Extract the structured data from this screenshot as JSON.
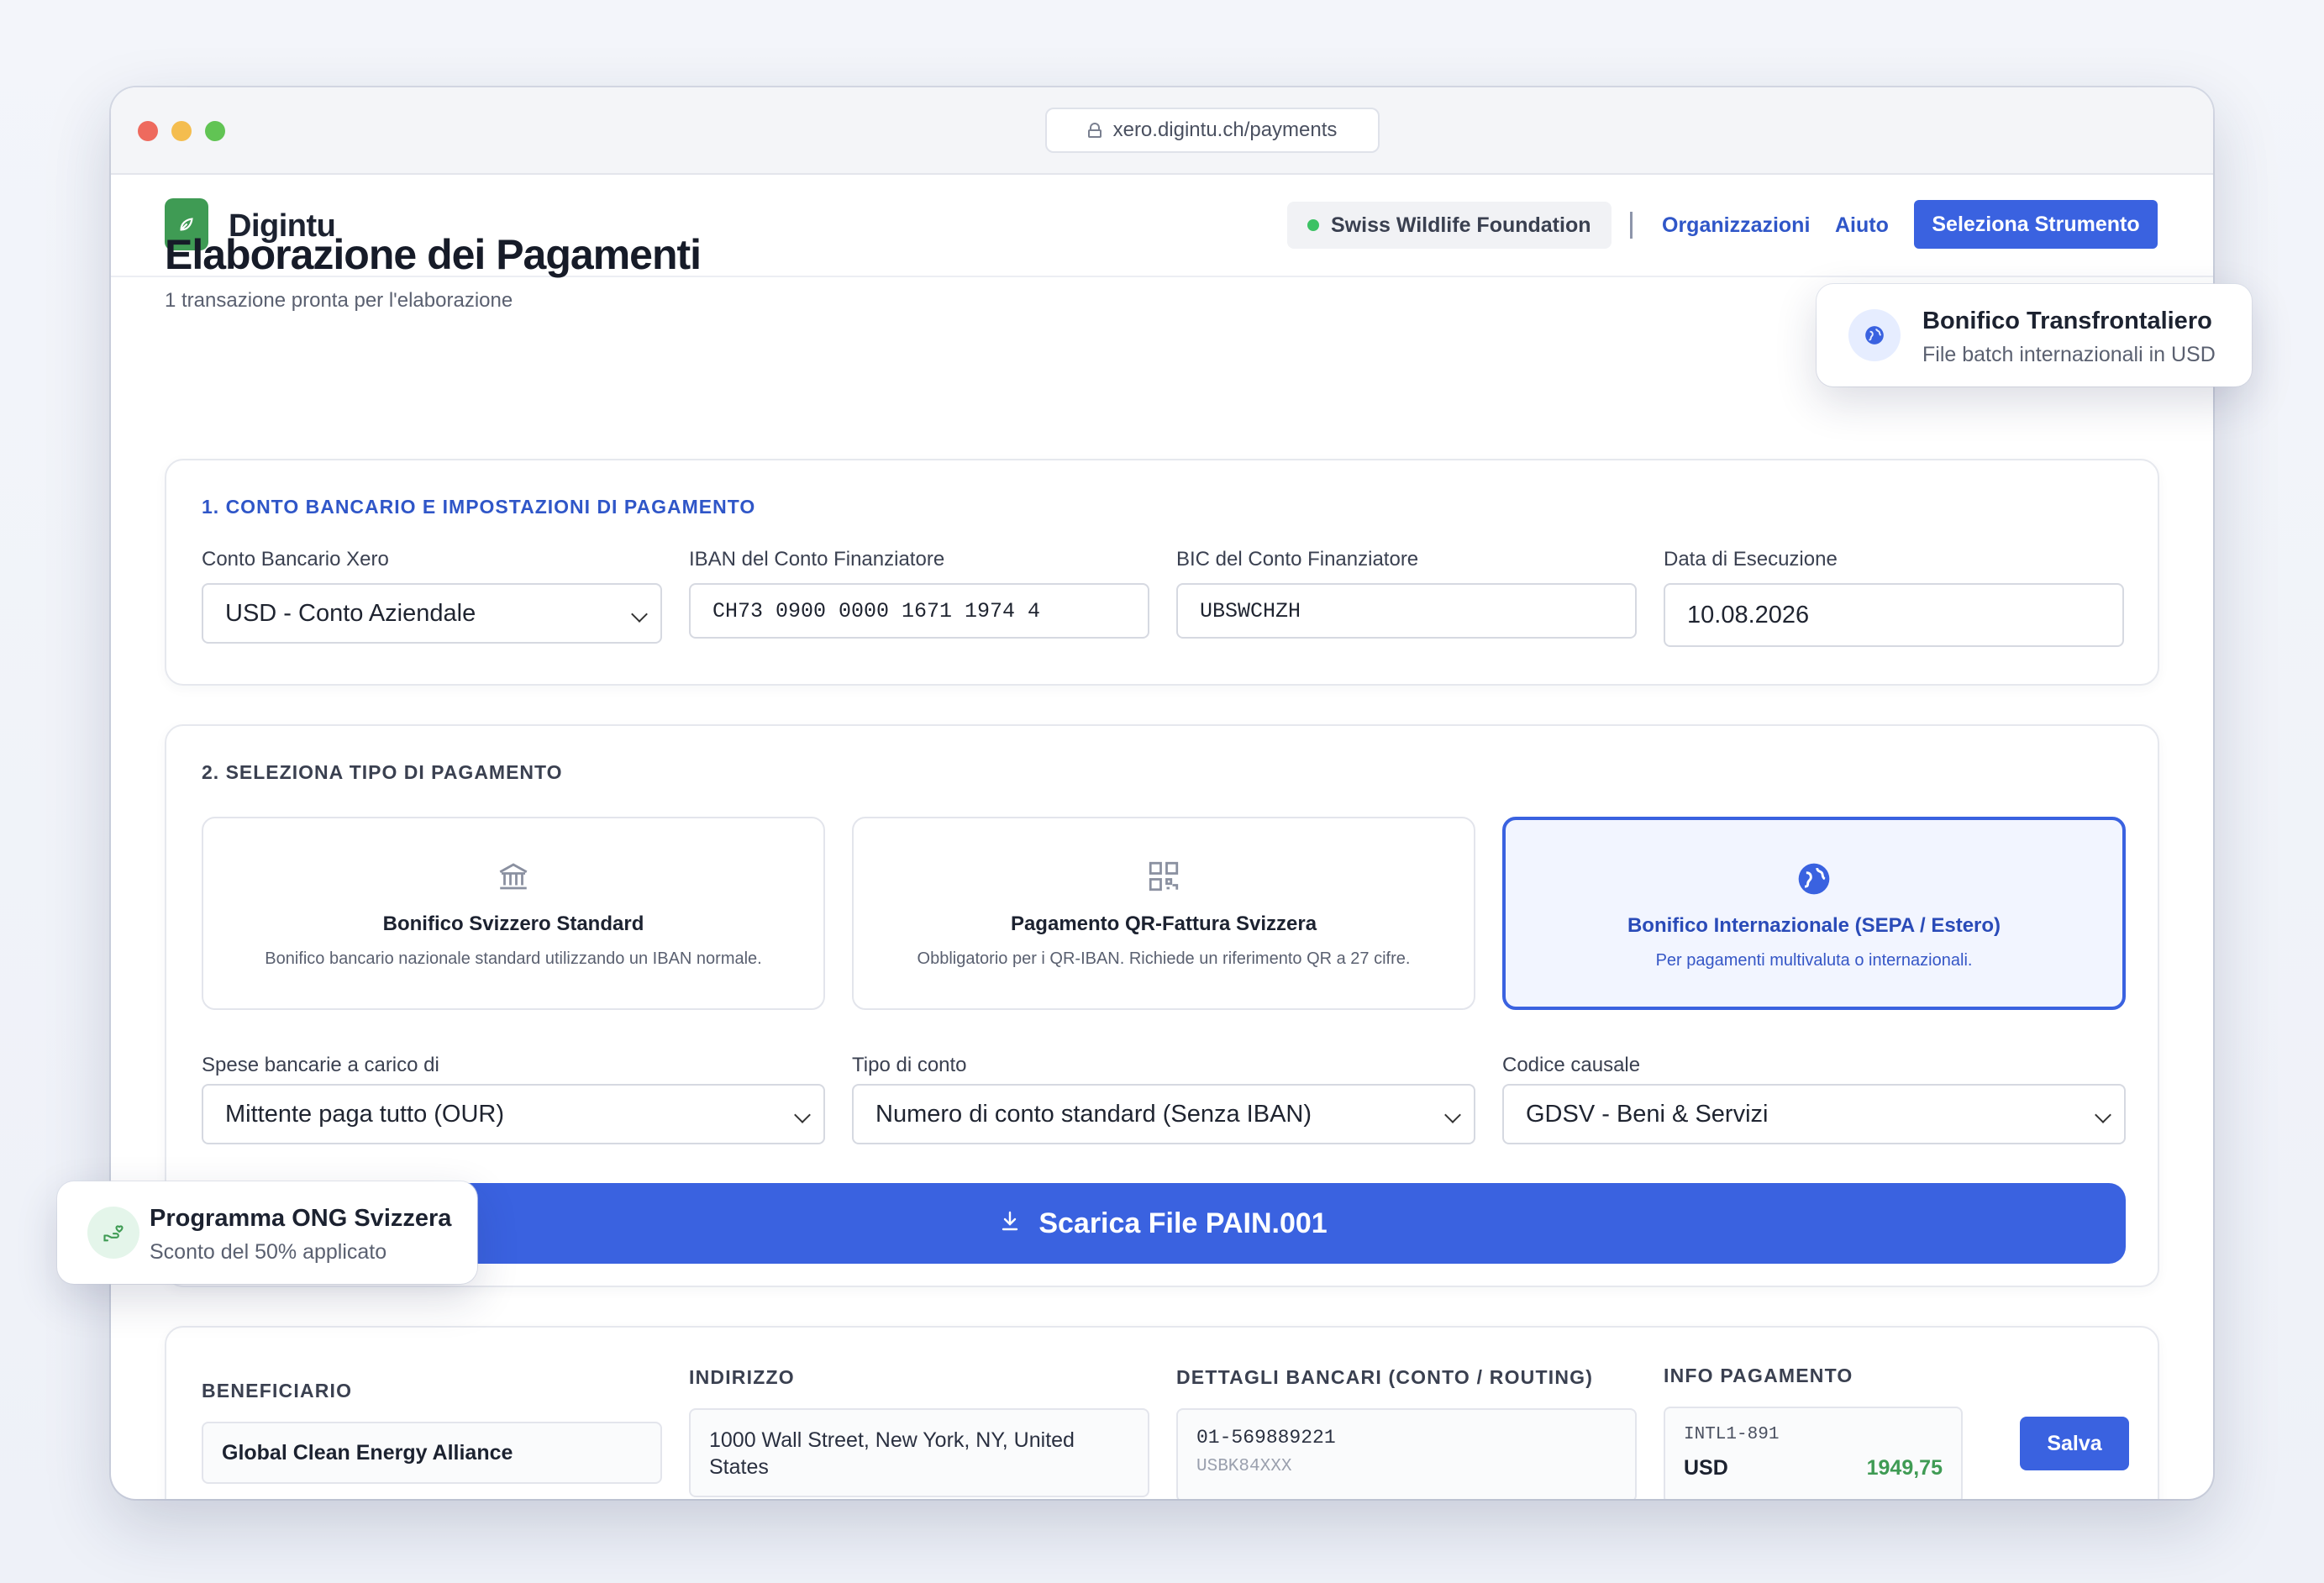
{
  "browser": {
    "url": "xero.digintu.ch/payments"
  },
  "header": {
    "brand": "Digintu",
    "organization": "Swiss Wildlife Foundation",
    "nav": {
      "organizations": "Organizzazioni",
      "help": "Aiuto"
    },
    "select_tool": "Seleziona Strumento"
  },
  "page": {
    "title": "Elaborazione dei Pagamenti",
    "subtitle": "1 transazione pronta per l'elaborazione"
  },
  "section1": {
    "title": "1. CONTO BANCARIO E IMPOSTAZIONI DI PAGAMENTO",
    "xero_account": {
      "label": "Conto Bancario Xero",
      "value": "USD - Conto Aziendale"
    },
    "iban": {
      "label": "IBAN del Conto Finanziatore",
      "value": "CH73 0900 0000 1671 1974 4"
    },
    "bic": {
      "label": "BIC del Conto Finanziatore",
      "value": "UBSWCHZH"
    },
    "date": {
      "label": "Data di Esecuzione",
      "value": "10.08.2026"
    }
  },
  "section2": {
    "title": "2. SELEZIONA TIPO DI PAGAMENTO",
    "types": [
      {
        "title": "Bonifico Svizzero Standard",
        "desc": "Bonifico bancario nazionale standard utilizzando un IBAN normale.",
        "icon": "bank-icon"
      },
      {
        "title": "Pagamento QR-Fattura Svizzera",
        "desc": "Obbligatorio per i QR-IBAN. Richiede un riferimento QR a 27 cifre.",
        "icon": "qr-icon"
      },
      {
        "title": "Bonifico Internazionale (SEPA / Estero)",
        "desc": "Per pagamenti multivaluta o internazionali.",
        "icon": "globe-icon"
      }
    ],
    "charges": {
      "label": "Spese bancarie a carico di",
      "value": "Mittente paga tutto (OUR)"
    },
    "account_type": {
      "label": "Tipo di conto",
      "value": "Numero di conto standard (Senza IBAN)"
    },
    "purpose": {
      "label": "Codice causale",
      "value": "GDSV - Beni & Servizi"
    },
    "download": "Scarica File PAIN.001"
  },
  "table": {
    "headers": {
      "beneficiary": "BENEFICIARIO",
      "address": "INDIRIZZO",
      "bank": "DETTAGLI BANCARI (CONTO / ROUTING)",
      "payment": "INFO PAGAMENTO"
    },
    "row": {
      "beneficiary": "Global Clean Energy Alliance",
      "address": "1000 Wall Street, New York, NY, United States",
      "account": "01-569889221",
      "routing": "USBK84XXX",
      "ref": "INTL1-891",
      "currency": "USD",
      "amount": "1949,75",
      "save": "Salva"
    }
  },
  "toasts": {
    "intl": {
      "title": "Bonifico Transfrontaliero",
      "sub": "File batch internazionali in USD"
    },
    "ngo": {
      "title": "Programma ONG Svizzera",
      "sub": "Sconto del 50% applicato"
    }
  },
  "colors": {
    "accent": "#3a62e0",
    "brand": "#3f9b54",
    "amount": "#3f9b54"
  }
}
